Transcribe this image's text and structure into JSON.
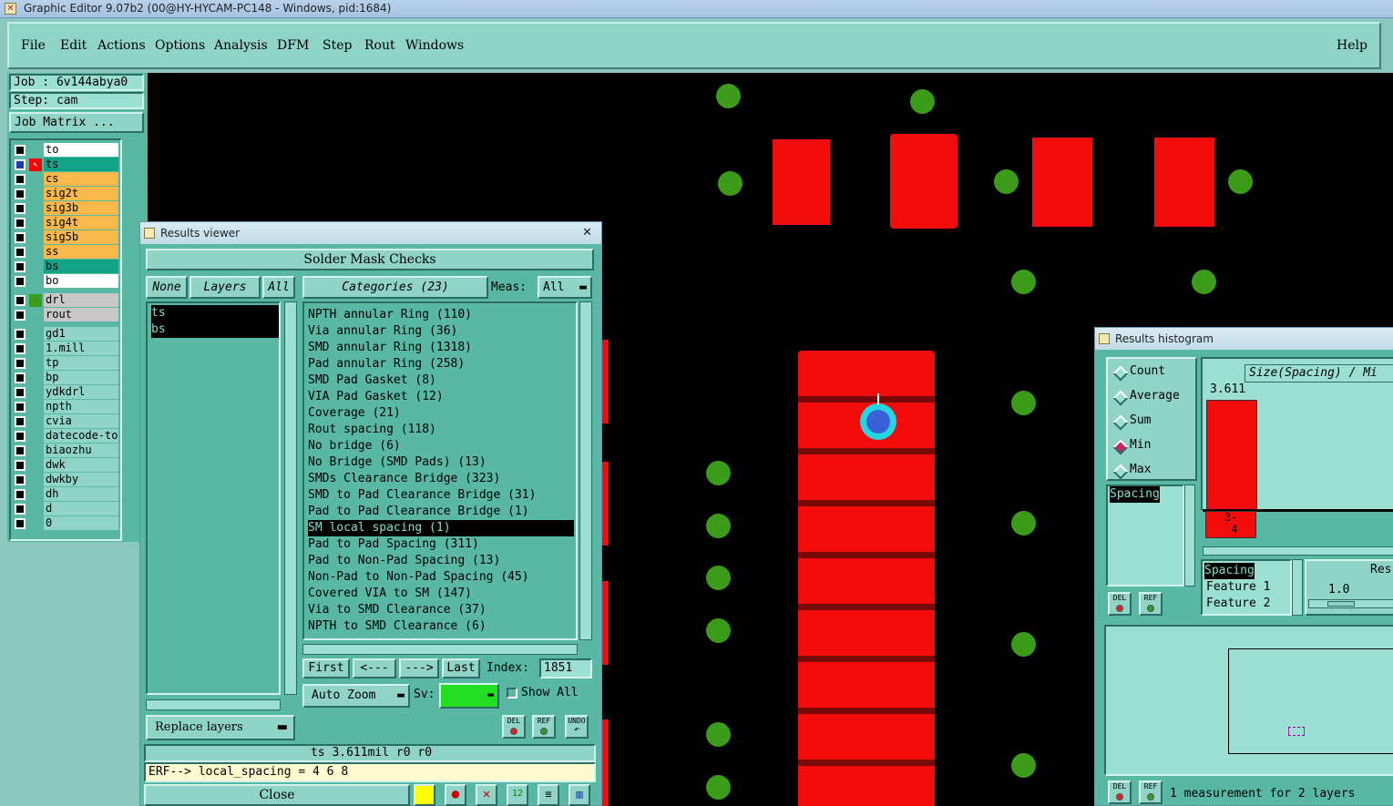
{
  "window": {
    "title": "Graphic Editor 9.07b2 (00@HY-HYCAM-PC148 - Windows, pid:1684)"
  },
  "menu": {
    "items": [
      "File",
      "Edit",
      "Actions",
      "Options",
      "Analysis",
      "DFM",
      "Step",
      "Rout",
      "Windows"
    ],
    "help": "Help"
  },
  "job": {
    "job_label": "Job : 6v144abya0",
    "step_label": "Step: cam",
    "matrix_button": "Job Matrix ..."
  },
  "layers_group1": [
    "to",
    "ts",
    "cs",
    "sig2t",
    "sig3b",
    "sig4t",
    "sig5b",
    "ss",
    "bs",
    "bo"
  ],
  "layers_group2": [
    "drl",
    "rout"
  ],
  "layers_group3": [
    "gd1",
    "1.mill",
    "tp",
    "bp",
    "ydkdrl",
    "npth",
    "cvia",
    "datecode-to",
    "biaozhu",
    "dwk",
    "dwkby",
    "dh",
    "d",
    "0"
  ],
  "results_viewer": {
    "title": "Results viewer",
    "close_x": "✕",
    "header": "Solder Mask Checks",
    "none_btn": "None",
    "layers_btn": "Layers",
    "all_btn": "All",
    "layer_list": [
      "ts",
      "bs"
    ],
    "categories_btn": "Categories (23)",
    "meas_label": "Meas:",
    "meas_value": "All",
    "categories": [
      "NPTH annular Ring (110)",
      "Via annular Ring (36)",
      "SMD annular Ring (1318)",
      "Pad annular Ring (258)",
      "SMD Pad Gasket (8)",
      "VIA Pad Gasket (12)",
      "Coverage (21)",
      "Rout spacing (118)",
      "No bridge (6)",
      "No Bridge (SMD Pads) (13)",
      "SMDs Clearance Bridge (323)",
      "SMD to Pad Clearance Bridge (31)",
      "Pad to Pad Clearance Bridge (1)",
      "SM local spacing (1)",
      "Pad to Pad Spacing (311)",
      "Pad to Non-Pad Spacing (13)",
      "Non-Pad to Non-Pad Spacing (45)",
      "Covered VIA to SM (147)",
      "Via to SMD Clearance (37)",
      "NPTH to SMD Clearance (6)"
    ],
    "selected_category": 13,
    "nav": {
      "first": "First",
      "prev": "<---",
      "next": "--->",
      "last": "Last",
      "index_label": "Index:",
      "index_value": "1851"
    },
    "auto_zoom": "Auto Zoom",
    "sv_label": "Sv:",
    "show_all": "Show All",
    "replace_layers": "Replace layers",
    "del": "DEL",
    "ref": "REF",
    "undo": "UNDO",
    "status": "ts 3.611mil  r0  r0",
    "erf": "ERF--> local_spacing = 4 6 8",
    "close": "Close"
  },
  "histogram": {
    "title": "Results histogram",
    "modes": [
      "Count",
      "Average",
      "Sum",
      "Min",
      "Max"
    ],
    "selected_mode": "Min",
    "axis_title": "Size(Spacing) / Mi",
    "bar_value_label": "3.611",
    "bar_fraction": 0.93,
    "bin_label_top": "3-",
    "bin_label_bottom": "4",
    "list_item": "Spacing",
    "attr_list": [
      "Spacing",
      "Feature 1",
      "Feature 2"
    ],
    "res_label": "Res",
    "res_value": "1.0",
    "summary": "1 measurement for 2 layers"
  }
}
